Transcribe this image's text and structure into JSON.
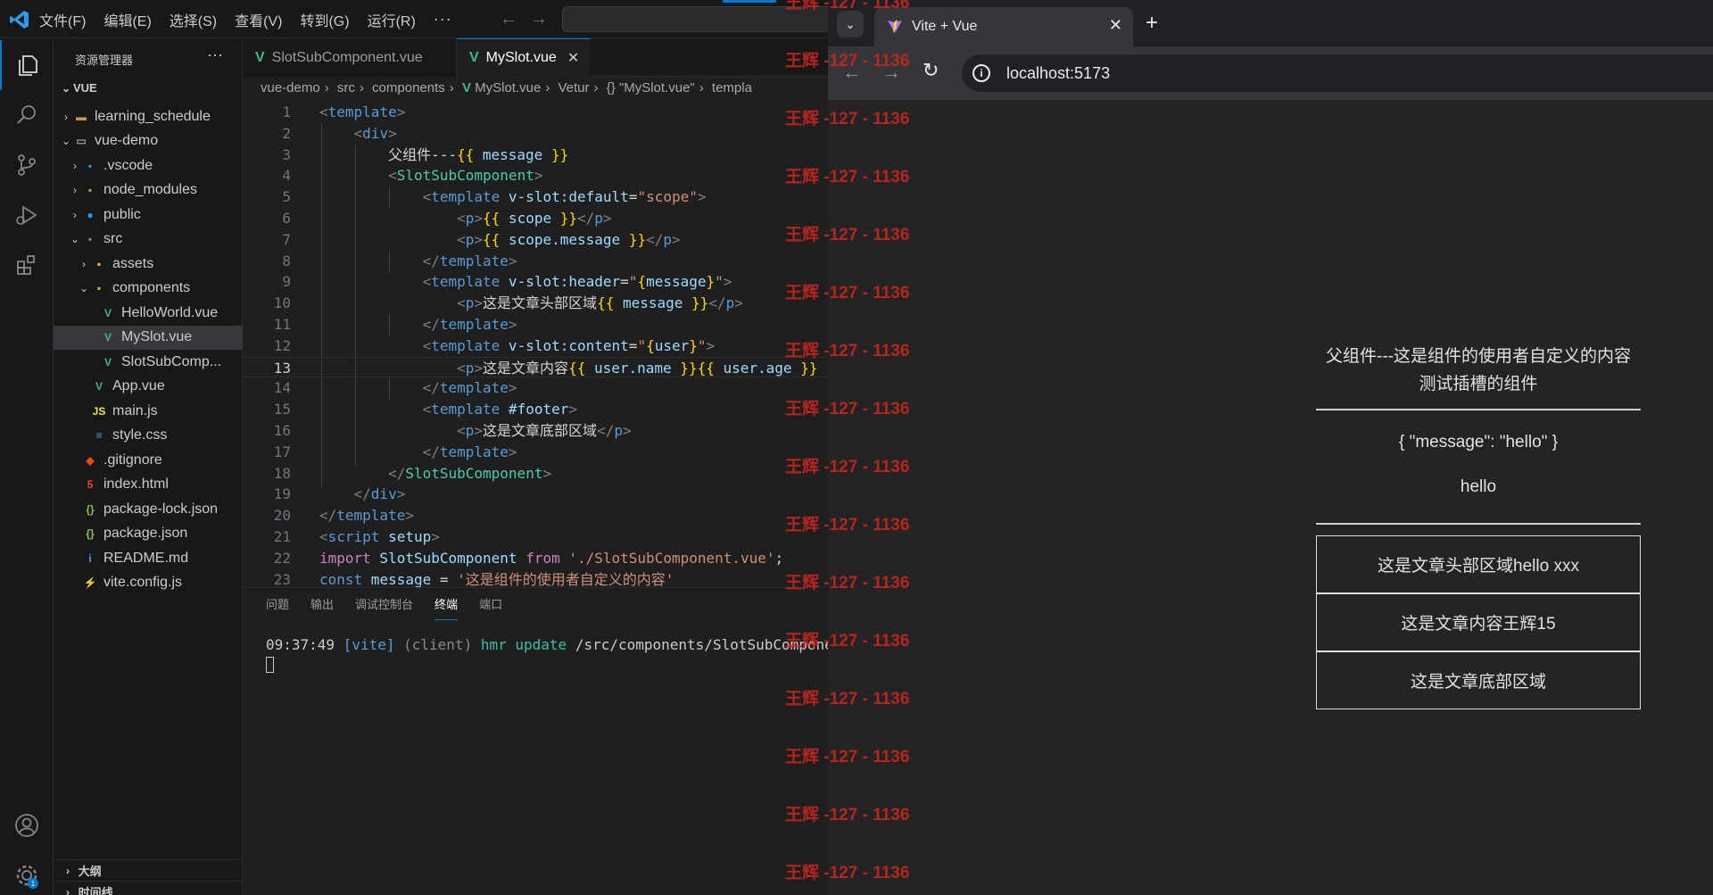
{
  "vscode": {
    "menu": [
      "文件(F)",
      "编辑(E)",
      "选择(S)",
      "查看(V)",
      "转到(G)",
      "运行(R)"
    ],
    "menu_more": "···",
    "explorer_title": "资源管理器",
    "explorer_more": "···",
    "section": "VUE",
    "tree": [
      {
        "label": "learning_schedule",
        "chev": "›",
        "indent": 1,
        "icon": "folder"
      },
      {
        "label": "vue-demo",
        "chev": "⌄",
        "indent": 1,
        "icon": "folder-open"
      },
      {
        "label": ".vscode",
        "chev": "›",
        "indent": 2,
        "icon": "folder-vscode"
      },
      {
        "label": "node_modules",
        "chev": "›",
        "indent": 2,
        "icon": "folder-node"
      },
      {
        "label": "public",
        "chev": "›",
        "indent": 2,
        "icon": "folder-public"
      },
      {
        "label": "src",
        "chev": "⌄",
        "indent": 2,
        "icon": "folder-src"
      },
      {
        "label": "assets",
        "chev": "›",
        "indent": 3,
        "icon": "folder-assets"
      },
      {
        "label": "components",
        "chev": "⌄",
        "indent": 3,
        "icon": "folder-components"
      },
      {
        "label": "HelloWorld.vue",
        "chev": "",
        "indent": 4,
        "icon": "vue"
      },
      {
        "label": "MySlot.vue",
        "chev": "",
        "indent": 4,
        "icon": "vue",
        "selected": true
      },
      {
        "label": "SlotSubComp...",
        "chev": "",
        "indent": 4,
        "icon": "vue"
      },
      {
        "label": "App.vue",
        "chev": "",
        "indent": 3,
        "icon": "vue"
      },
      {
        "label": "main.js",
        "chev": "",
        "indent": 3,
        "icon": "js"
      },
      {
        "label": "style.css",
        "chev": "",
        "indent": 3,
        "icon": "css"
      },
      {
        "label": ".gitignore",
        "chev": "",
        "indent": 2,
        "icon": "git"
      },
      {
        "label": "index.html",
        "chev": "",
        "indent": 2,
        "icon": "html"
      },
      {
        "label": "package-lock.json",
        "chev": "",
        "indent": 2,
        "icon": "json"
      },
      {
        "label": "package.json",
        "chev": "",
        "indent": 2,
        "icon": "json"
      },
      {
        "label": "README.md",
        "chev": "",
        "indent": 2,
        "icon": "info"
      },
      {
        "label": "vite.config.js",
        "chev": "",
        "indent": 2,
        "icon": "vite"
      }
    ],
    "outline": "大纲",
    "timeline": "时间线",
    "tabs": [
      {
        "label": "SlotSubComponent.vue",
        "active": false
      },
      {
        "label": "MySlot.vue",
        "active": true
      }
    ],
    "breadcrumb": [
      "vue-demo",
      "src",
      "components",
      "MySlot.vue",
      "Vetur",
      "{} \"MySlot.vue\"",
      "templa"
    ],
    "current_line": 13,
    "code": [
      [
        [
          "t-tag",
          "<"
        ],
        [
          "t-name",
          "template"
        ],
        [
          "t-tag",
          ">"
        ]
      ],
      [
        [
          "t-plain",
          "    "
        ],
        [
          "t-tag",
          "<"
        ],
        [
          "t-name",
          "div"
        ],
        [
          "t-tag",
          ">"
        ]
      ],
      [
        [
          "t-plain",
          "        "
        ],
        [
          "t-text",
          "父组件---"
        ],
        [
          "t-br",
          "{{"
        ],
        [
          "t-var",
          " message "
        ],
        [
          "t-br",
          "}}"
        ]
      ],
      [
        [
          "t-plain",
          "        "
        ],
        [
          "t-tag",
          "<"
        ],
        [
          "t-comp",
          "SlotSubComponent"
        ],
        [
          "t-tag",
          ">"
        ]
      ],
      [
        [
          "t-plain",
          "            "
        ],
        [
          "t-tag",
          "<"
        ],
        [
          "t-name",
          "template"
        ],
        [
          "t-attr",
          " v-slot:default"
        ],
        [
          "t-plain",
          "="
        ],
        [
          "t-str",
          "\"scope\""
        ],
        [
          "t-tag",
          ">"
        ]
      ],
      [
        [
          "t-plain",
          "                "
        ],
        [
          "t-tag",
          "<"
        ],
        [
          "t-name",
          "p"
        ],
        [
          "t-tag",
          ">"
        ],
        [
          "t-br",
          "{{"
        ],
        [
          "t-var",
          " scope "
        ],
        [
          "t-br",
          "}}"
        ],
        [
          "t-tag",
          "</"
        ],
        [
          "t-name",
          "p"
        ],
        [
          "t-tag",
          ">"
        ]
      ],
      [
        [
          "t-plain",
          "                "
        ],
        [
          "t-tag",
          "<"
        ],
        [
          "t-name",
          "p"
        ],
        [
          "t-tag",
          ">"
        ],
        [
          "t-br",
          "{{"
        ],
        [
          "t-var",
          " scope.message "
        ],
        [
          "t-br",
          "}}"
        ],
        [
          "t-tag",
          "</"
        ],
        [
          "t-name",
          "p"
        ],
        [
          "t-tag",
          ">"
        ]
      ],
      [
        [
          "t-plain",
          "            "
        ],
        [
          "t-tag",
          "</"
        ],
        [
          "t-name",
          "template"
        ],
        [
          "t-tag",
          ">"
        ]
      ],
      [
        [
          "t-plain",
          "            "
        ],
        [
          "t-tag",
          "<"
        ],
        [
          "t-name",
          "template"
        ],
        [
          "t-attr",
          " v-slot:header"
        ],
        [
          "t-plain",
          "="
        ],
        [
          "t-str",
          "\""
        ],
        [
          "t-br",
          "{"
        ],
        [
          "t-var",
          "message"
        ],
        [
          "t-br",
          "}"
        ],
        [
          "t-str",
          "\""
        ],
        [
          "t-tag",
          ">"
        ]
      ],
      [
        [
          "t-plain",
          "                "
        ],
        [
          "t-tag",
          "<"
        ],
        [
          "t-name",
          "p"
        ],
        [
          "t-tag",
          ">"
        ],
        [
          "t-text",
          "这是文章头部区域"
        ],
        [
          "t-br",
          "{{"
        ],
        [
          "t-var",
          " message "
        ],
        [
          "t-br",
          "}}"
        ],
        [
          "t-tag",
          "</"
        ],
        [
          "t-name",
          "p"
        ],
        [
          "t-tag",
          ">"
        ]
      ],
      [
        [
          "t-plain",
          "            "
        ],
        [
          "t-tag",
          "</"
        ],
        [
          "t-name",
          "template"
        ],
        [
          "t-tag",
          ">"
        ]
      ],
      [
        [
          "t-plain",
          "            "
        ],
        [
          "t-tag",
          "<"
        ],
        [
          "t-name",
          "template"
        ],
        [
          "t-attr",
          " v-slot:content"
        ],
        [
          "t-plain",
          "="
        ],
        [
          "t-str",
          "\""
        ],
        [
          "t-br",
          "{"
        ],
        [
          "t-var",
          "user"
        ],
        [
          "t-br",
          "}"
        ],
        [
          "t-str",
          "\""
        ],
        [
          "t-tag",
          ">"
        ]
      ],
      [
        [
          "t-plain",
          "                "
        ],
        [
          "t-tag",
          "<"
        ],
        [
          "t-name",
          "p"
        ],
        [
          "t-tag",
          ">"
        ],
        [
          "t-text",
          "这是文章内容"
        ],
        [
          "t-br",
          "{{"
        ],
        [
          "t-var",
          " user.name "
        ],
        [
          "t-br",
          "}}{{"
        ],
        [
          "t-var",
          " user.age "
        ],
        [
          "t-br",
          "}}"
        ]
      ],
      [
        [
          "t-plain",
          "            "
        ],
        [
          "t-tag",
          "</"
        ],
        [
          "t-name",
          "template"
        ],
        [
          "t-tag",
          ">"
        ]
      ],
      [
        [
          "t-plain",
          "            "
        ],
        [
          "t-tag",
          "<"
        ],
        [
          "t-name",
          "template"
        ],
        [
          "t-attr",
          " #footer"
        ],
        [
          "t-tag",
          ">"
        ]
      ],
      [
        [
          "t-plain",
          "                "
        ],
        [
          "t-tag",
          "<"
        ],
        [
          "t-name",
          "p"
        ],
        [
          "t-tag",
          ">"
        ],
        [
          "t-text",
          "这是文章底部区域"
        ],
        [
          "t-tag",
          "</"
        ],
        [
          "t-name",
          "p"
        ],
        [
          "t-tag",
          ">"
        ]
      ],
      [
        [
          "t-plain",
          "            "
        ],
        [
          "t-tag",
          "</"
        ],
        [
          "t-name",
          "template"
        ],
        [
          "t-tag",
          ">"
        ]
      ],
      [
        [
          "t-plain",
          "        "
        ],
        [
          "t-tag",
          "</"
        ],
        [
          "t-comp",
          "SlotSubComponent"
        ],
        [
          "t-tag",
          ">"
        ]
      ],
      [
        [
          "t-plain",
          "    "
        ],
        [
          "t-tag",
          "</"
        ],
        [
          "t-name",
          "div"
        ],
        [
          "t-tag",
          ">"
        ]
      ],
      [
        [
          "t-tag",
          "</"
        ],
        [
          "t-name",
          "template"
        ],
        [
          "t-tag",
          ">"
        ]
      ],
      [
        [
          "t-tag",
          "<"
        ],
        [
          "t-name",
          "script"
        ],
        [
          "t-attr",
          " setup"
        ],
        [
          "t-tag",
          ">"
        ]
      ],
      [
        [
          "t-kw",
          "import"
        ],
        [
          "t-var",
          " SlotSubComponent "
        ],
        [
          "t-kw",
          "from"
        ],
        [
          "t-plain",
          " "
        ],
        [
          "t-str",
          "'./SlotSubComponent.vue'"
        ],
        [
          "t-plain",
          ";"
        ]
      ],
      [
        [
          "t-name",
          "const"
        ],
        [
          "t-var",
          " message "
        ],
        [
          "t-plain",
          "= "
        ],
        [
          "t-str",
          "'这是组件的使用者自定义的内容'"
        ]
      ]
    ],
    "panel_tabs": [
      "问题",
      "输出",
      "调试控制台",
      "终端",
      "端口"
    ],
    "panel_active": "终端",
    "terminal": {
      "time": "09:37:49",
      "tag": "[vite]",
      "client": "(client)",
      "hmr": "hmr update",
      "path": "/src/components/SlotSubComponent.v"
    }
  },
  "browser": {
    "tab_title": "Vite + Vue",
    "url": "localhost:5173",
    "page": {
      "parent_text": "父组件---这是组件的使用者自定义的内容",
      "child_title": "测试插槽的组件",
      "scope_json": "{ \"message\": \"hello\" }",
      "scope_message": "hello",
      "header_text": "这是文章头部区域hello xxx",
      "content_text": "这是文章内容王辉15",
      "footer_text": "这是文章底部区域"
    }
  },
  "watermark": {
    "text": "王辉 -127 - 1136",
    "count": 16
  }
}
